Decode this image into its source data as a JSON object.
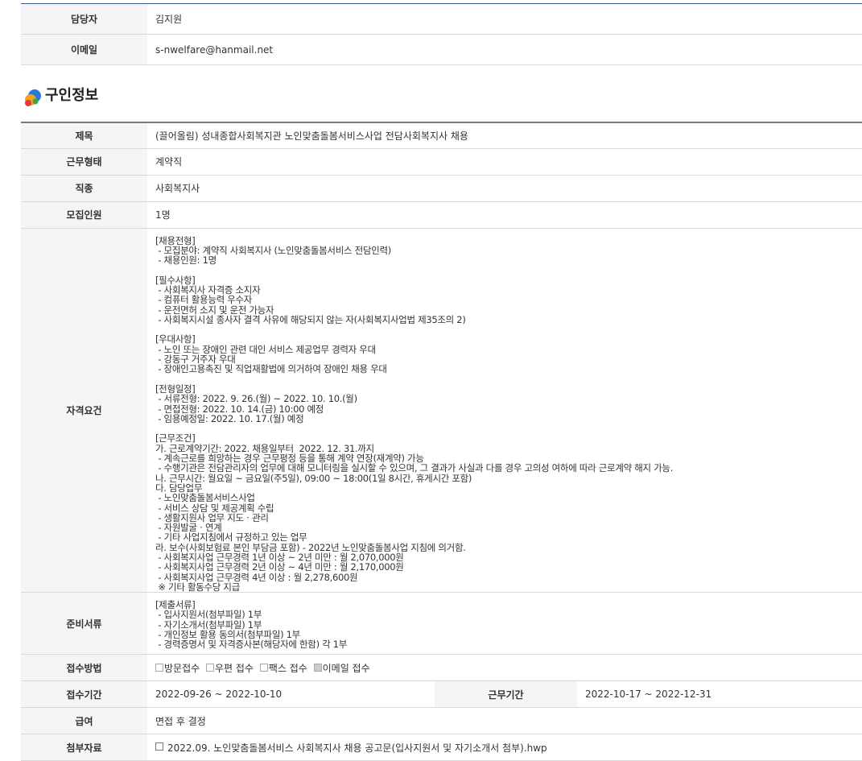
{
  "contact": {
    "manager_label": "담당자",
    "manager_value": "김지원",
    "email_label": "이메일",
    "email_value": "s-nwelfare@hanmail.net"
  },
  "section": {
    "title": "구인정보"
  },
  "job": {
    "title_label": "제목",
    "title_value": "(끌어올림) 성내종합사회복지관 노인맞춤돌봄서비스사업 전담사회복지사 채용",
    "employment_type_label": "근무형태",
    "employment_type_value": "계약직",
    "occupation_label": "직종",
    "occupation_value": "사회복지사",
    "headcount_label": "모집인원",
    "headcount_value": "1명",
    "qualification_label": "자격요건",
    "qualification_value": "[채용전형]\n - 모집분야: 계약직 사회복지사 (노인맞춤돌봄서비스 전담인력)\n - 채용인원: 1명\n\n[필수사항]\n - 사회복지사 자격증 소지자\n - 컴퓨터 활용능력 우수자\n - 운전면허 소지 및 운전 가능자\n - 사회복지시설 종사자 결격 사유에 해당되지 않는 자(사회복지사업법 제35조의 2)\n\n[우대사항]\n - 노인 또는 장애인 관련 대인 서비스 제공업무 경력자 우대\n - 강동구 거주자 우대\n - 장애인고용촉진 및 직업재활법에 의거하여 장애인 채용 우대\n\n[전형일정]\n - 서류전형: 2022. 9. 26.(월) ~ 2022. 10. 10.(월)\n - 면접전형: 2022. 10. 14.(금) 10:00 예정\n - 임용예정일: 2022. 10. 17.(월) 예정\n\n[근무조건]\n가. 근로계약기간: 2022. 채용일부터  2022. 12. 31.까지\n - 계속근로를 희망하는 경우 근무평정 등을 통해 계약 연장(재계약) 가능\n - 수행기관은 전담관리자의 업무에 대해 모니터링을 실시할 수 있으며, 그 결과가 사실과 다를 경우 고의성 여하에 따라 근로계약 해지 가능.\n나. 근무시간: 월요일 ~ 금요일(주5일), 09:00 ~ 18:00(1일 8시간, 휴게시간 포함)\n다. 담당업무\n - 노인맞춤돌봄서비스사업\n - 서비스 상담 및 제공계획 수립\n - 생활지원사 업무 지도ㆍ관리\n - 자원발굴ㆍ연계\n - 기타 사업지침에서 규정하고 있는 업무\n라. 보수(사회보험료 본인 부담금 포함) - 2022년 노인맞춤돌봄사업 지침에 의거함.\n - 사회복지사업 근무경력 1년 이상 ~ 2년 미만 : 월 2,070,000원\n - 사회복지사업 근무경력 2년 이상 ~ 4년 미만 : 월 2,170,000원\n - 사회복지사업 근무경력 4년 이상 : 월 2,278,600원\n ※ 기타 활동수당 지급",
    "documents_label": "준비서류",
    "documents_value": "[제출서류]\n - 입사지원서(첨부파일) 1부\n - 자기소개서(첨부파일) 1부\n - 개인정보 활용 동의서(첨부파일) 1부\n - 경력증명서 및 자격증사본(해당자에 한함) 각 1부",
    "method_label": "접수방법",
    "methods": [
      {
        "label": "방문접수",
        "checked": false
      },
      {
        "label": "우편 접수",
        "checked": false
      },
      {
        "label": "팩스 접수",
        "checked": false
      },
      {
        "label": "이메일 접수",
        "checked": true
      }
    ],
    "period_label": "접수기간",
    "period_value": "2022-09-26 ~ 2022-10-10",
    "work_period_label": "근무기간",
    "work_period_value": "2022-10-17 ~ 2022-12-31",
    "salary_label": "급여",
    "salary_value": "면접 후 결정",
    "attachment_label": "첨부자료",
    "attachment_value": "2022.09. 노인맞춤돌봄서비스 사회복지사 채용 공고문(입사지원서 및 자기소개서 첨부).hwp"
  }
}
